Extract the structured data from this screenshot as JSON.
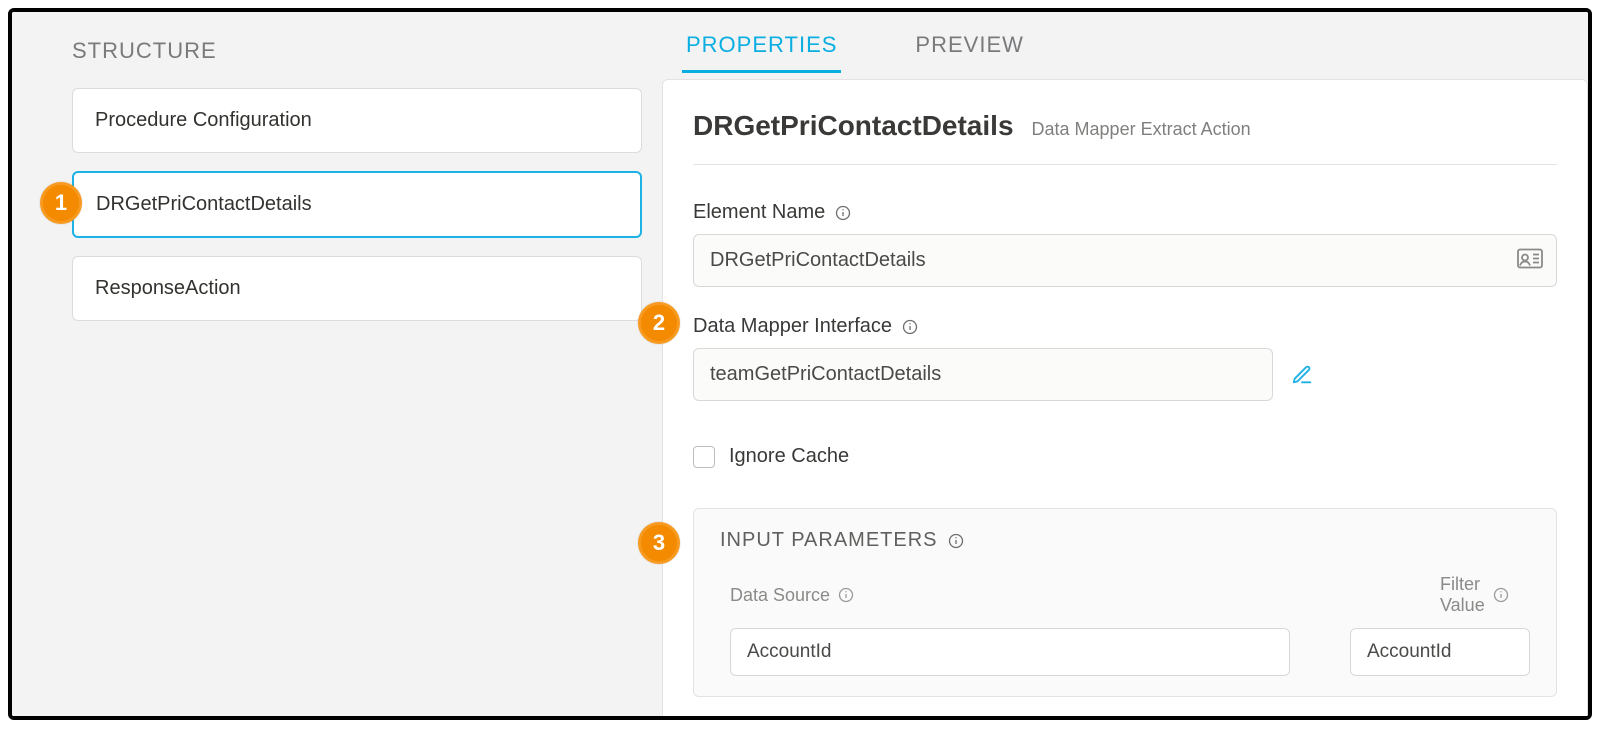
{
  "structure": {
    "heading": "STRUCTURE",
    "items": [
      {
        "label": "Procedure Configuration",
        "selected": false
      },
      {
        "label": "DRGetPriContactDetails",
        "selected": true
      },
      {
        "label": "ResponseAction",
        "selected": false
      }
    ]
  },
  "tabs": {
    "properties": "PROPERTIES",
    "preview": "PREVIEW",
    "active": "properties"
  },
  "properties": {
    "title": "DRGetPriContactDetails",
    "subtitle": "Data Mapper Extract Action",
    "element_name_label": "Element Name",
    "element_name_value": "DRGetPriContactDetails",
    "dm_interface_label": "Data Mapper Interface",
    "dm_interface_value": "teamGetPriContactDetails",
    "ignore_cache_label": "Ignore Cache",
    "ignore_cache_checked": false
  },
  "input_params": {
    "heading": "INPUT PARAMETERS",
    "columns": {
      "data_source": "Data Source",
      "filter_value": "Filter Value"
    },
    "rows": [
      {
        "data_source": "AccountId",
        "filter_value": "AccountId"
      }
    ]
  },
  "callouts": {
    "c1": "1",
    "c2": "2",
    "c3": "3"
  },
  "icons": {
    "info": "info",
    "edit": "pencil",
    "card": "id-card"
  }
}
